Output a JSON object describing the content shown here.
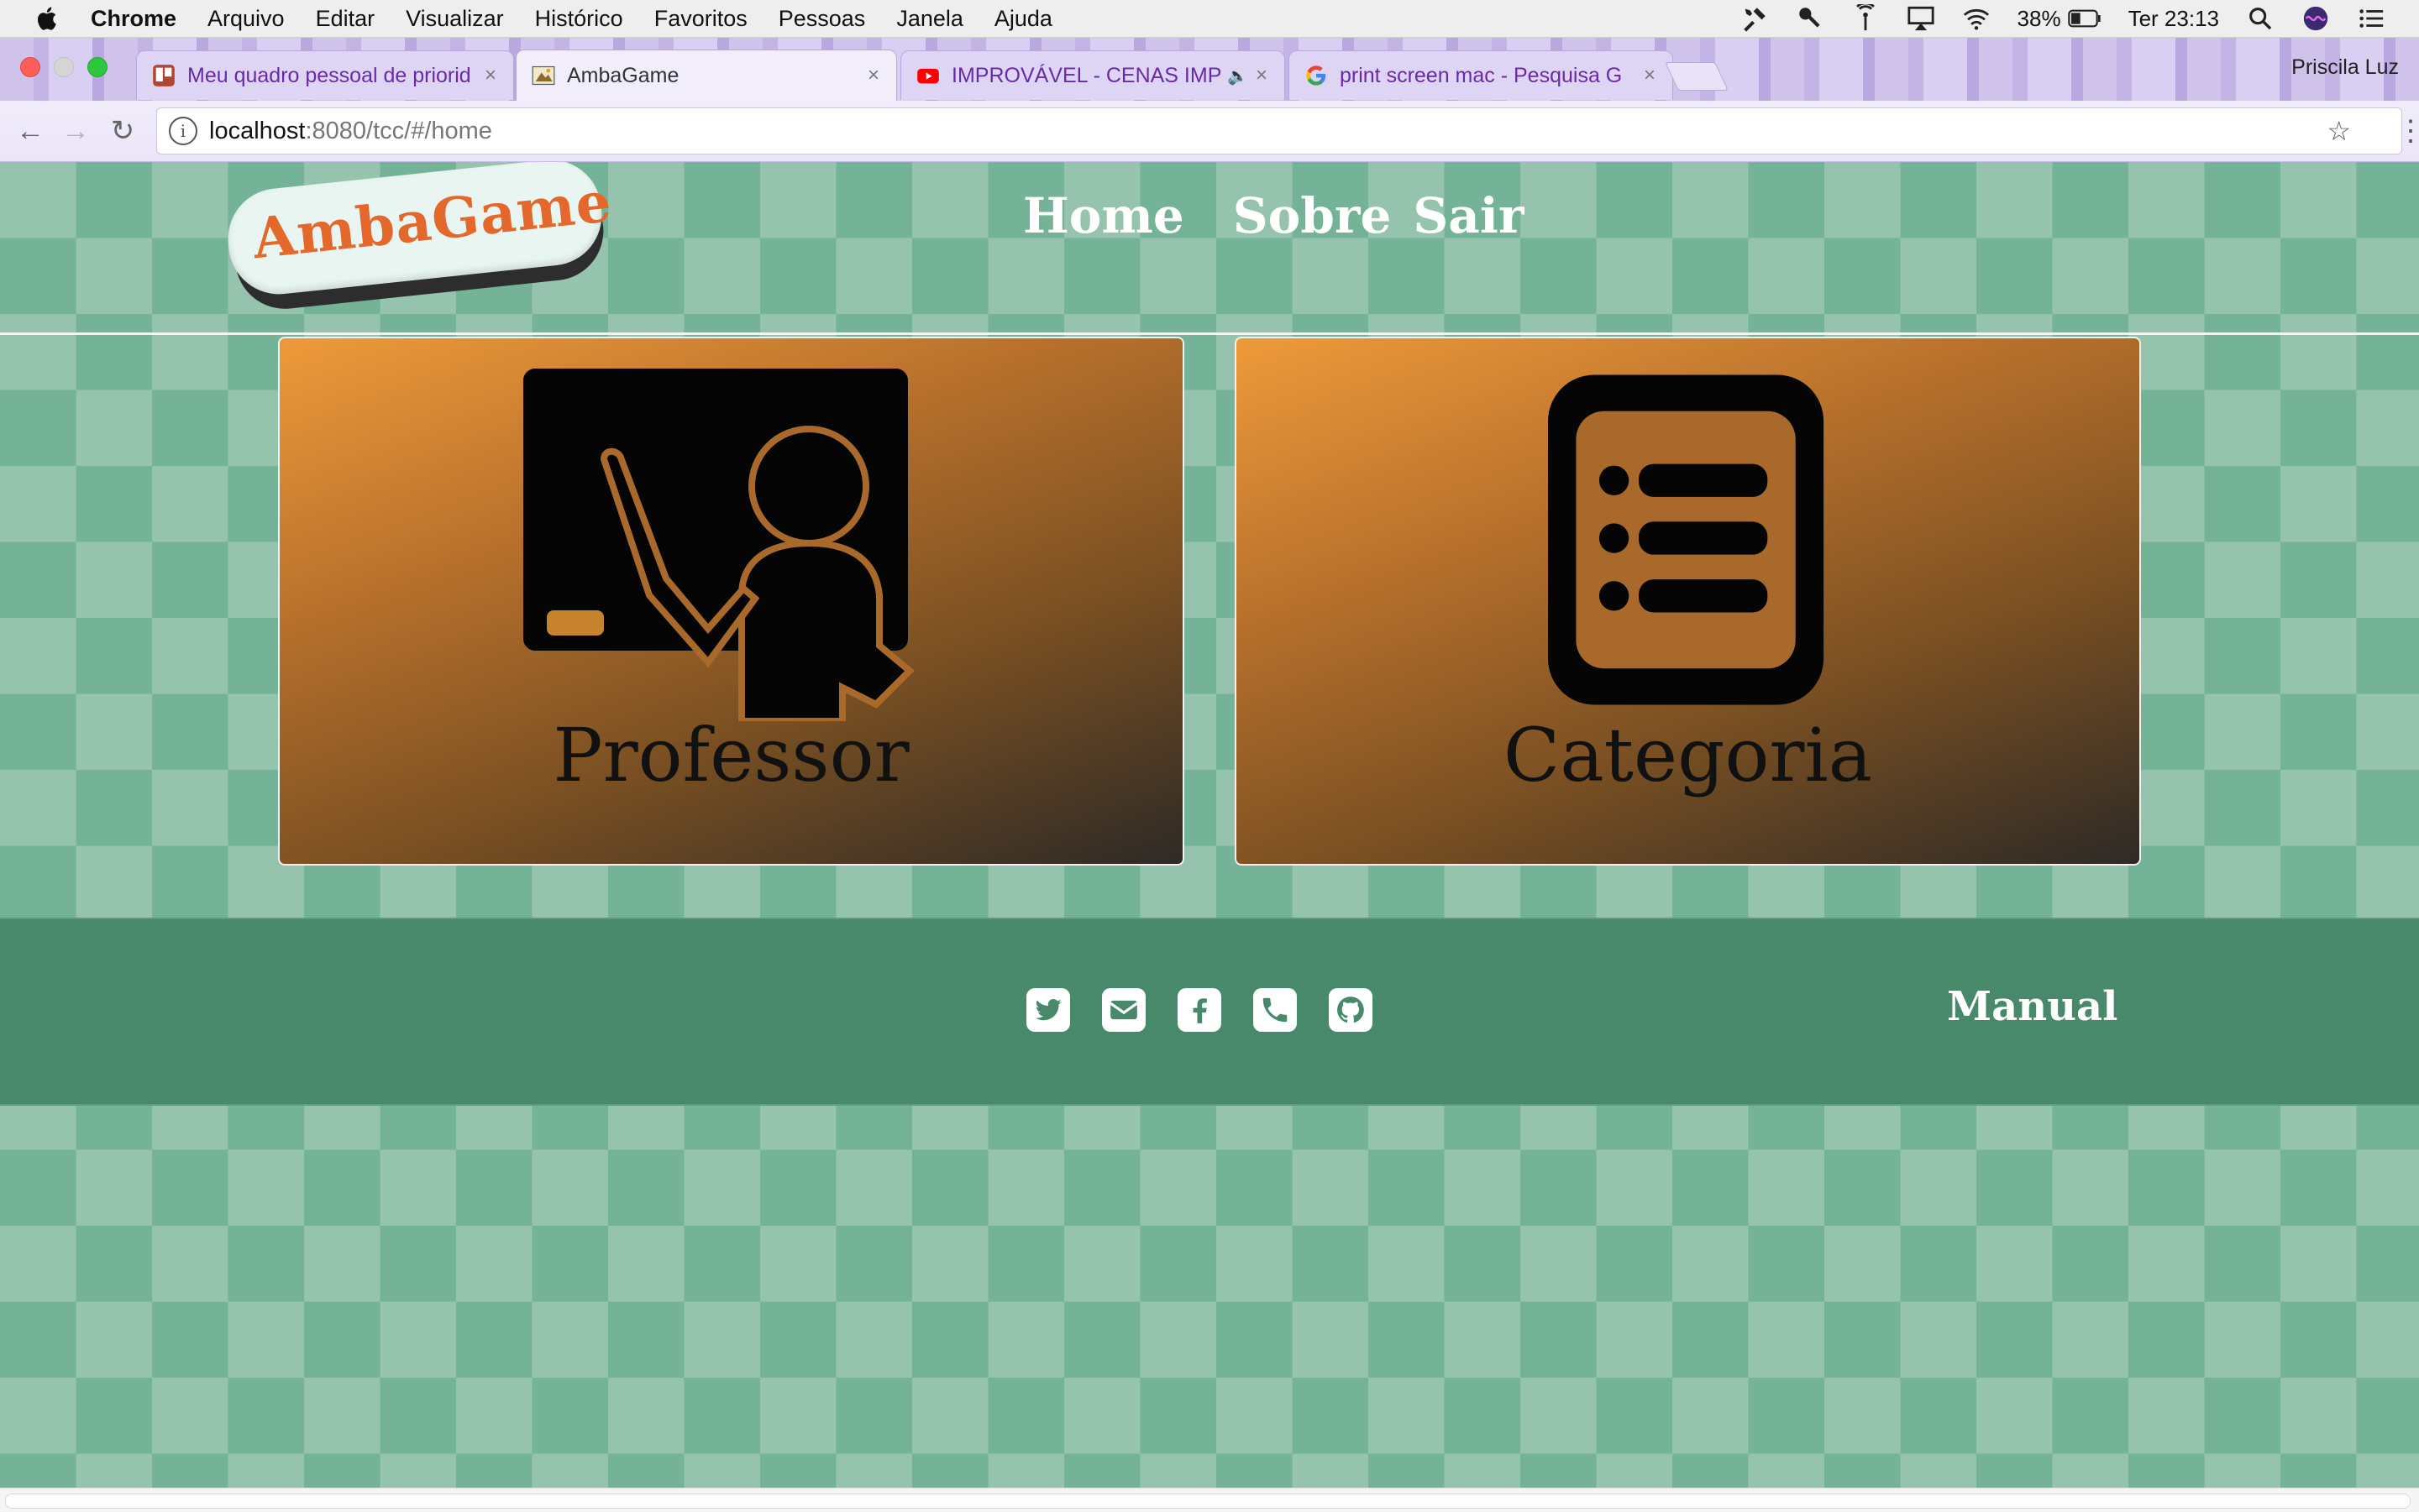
{
  "menubar": {
    "app": "Chrome",
    "items": [
      "Arquivo",
      "Editar",
      "Visualizar",
      "Histórico",
      "Favoritos",
      "Pessoas",
      "Janela",
      "Ajuda"
    ],
    "battery": "38%",
    "clock": "Ter 23:13"
  },
  "browser": {
    "tabs": [
      {
        "title": "Meu quadro pessoal de priorid",
        "icon": "trello-icon"
      },
      {
        "title": "AmbaGame",
        "icon": "ambagame-favicon"
      },
      {
        "title": "IMPROVÁVEL - CENAS IMP",
        "icon": "youtube-icon"
      },
      {
        "title": "print screen mac - Pesquisa G",
        "icon": "google-icon"
      }
    ],
    "active_tab": 1,
    "profile": "Priscila Luz",
    "url_host": "localhost",
    "url_path": ":8080/tcc/#/home"
  },
  "page": {
    "logo": "AmbaGame",
    "nav": {
      "home": "Home",
      "sobre": "Sobre",
      "sair": "Sair"
    },
    "cards": [
      {
        "label": "Professor",
        "icon": "teacher-blackboard-icon"
      },
      {
        "label": "Categoria",
        "icon": "list-document-icon"
      }
    ],
    "footer": {
      "social": [
        "twitter-icon",
        "envelope-icon",
        "facebook-icon",
        "phone-icon",
        "github-icon"
      ],
      "manual": "Manual"
    }
  },
  "colors": {
    "accent_logo": "#e4672c",
    "footer": "#47896a",
    "card_gradient_start": "#ee9a3a",
    "card_gradient_end": "#2e2a26"
  }
}
